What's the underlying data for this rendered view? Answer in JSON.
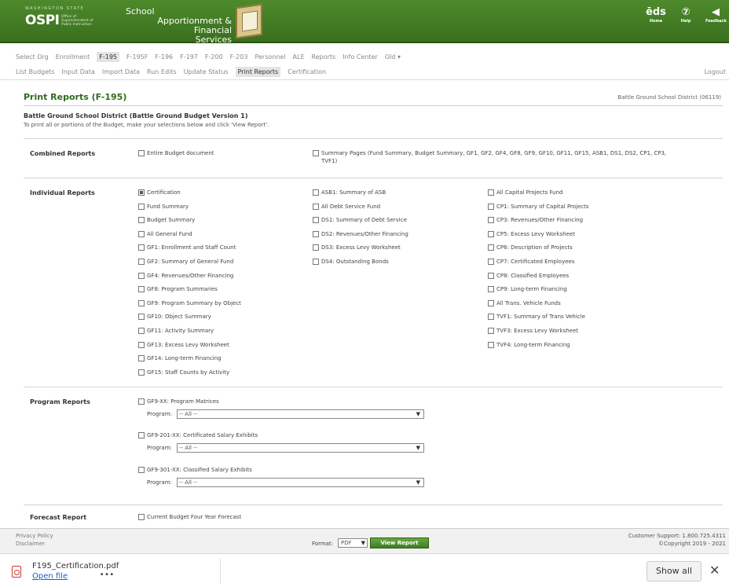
{
  "header": {
    "logo_small": "WASHINGTON STATE",
    "logo_main": "OSPI",
    "logo_sub": "Office of Superintendent of Public Instruction",
    "app_title_1": "School",
    "app_title_2": "Apportionment & Financial",
    "app_title_3": "Services",
    "icons": [
      {
        "glyph": "ēds",
        "label": "Home",
        "icon": "eds-home-icon"
      },
      {
        "glyph": "⑦",
        "label": "Help",
        "icon": "help-icon"
      },
      {
        "glyph": "◀",
        "label": "Feedback",
        "icon": "megaphone-icon"
      }
    ]
  },
  "nav1": {
    "items": [
      "Select Org",
      "Enrollment",
      "F-195",
      "F-195F",
      "F-196",
      "F-197",
      "F-200",
      "F-203",
      "Personnel",
      "ALE",
      "Reports",
      "Info Center",
      "Old ▾"
    ],
    "active_index": 2
  },
  "nav2": {
    "items": [
      "List Budgets",
      "Input Data",
      "Import Data",
      "Run Edits",
      "Update Status",
      "Print Reports",
      "Certification"
    ],
    "active_index": 5,
    "logout": "Logout"
  },
  "page": {
    "title": "Print Reports (F-195)",
    "district": "Battle Ground School District (06119)",
    "budget_name": "Battle Ground School District (Battle Ground Budget Version 1)",
    "instructions": "To print all or portions of the Budget, make your selections below and click 'View Report'."
  },
  "combined": {
    "label": "Combined Reports",
    "entire": "Entire Budget document",
    "summary": "Summary Pages (Fund Summary, Budget Summary, GF1, GF2, GF4, GF8, GF9, GF10, GF11, GF15, ASB1, DS1, DS2, CP1, CP3, TVF1)"
  },
  "individual": {
    "label": "Individual Reports",
    "col1": [
      "Certification",
      "Fund Summary",
      "Budget Summary",
      "All General Fund",
      "GF1: Enrollment and Staff Count",
      "GF2: Summary of General Fund",
      "GF4: Revenues/Other Financing",
      "GF8: Program Summaries",
      "GF9: Program Summary by Object",
      "GF10: Object Summary",
      "GF11: Activity Summary",
      "GF13: Excess Levy Worksheet",
      "GF14: Long-term Financing",
      "GF15: Staff Counts by Activity"
    ],
    "col2": [
      "ASB1: Summary of ASB",
      "All Debt Service Fund",
      "DS1: Summary of Debt Service",
      "DS2: Revenues/Other Financing",
      "DS3: Excess Levy Worksheet",
      "DS4: Outstanding Bonds"
    ],
    "col3": [
      "All Capital Projects Fund",
      "CP1: Summary of Capital Projects",
      "CP3: Revenues/Other Financing",
      "CP5: Excess Levy Worksheet",
      "CP6: Description of Projects",
      "CP7: Certificated Employees",
      "CP8: Classified Employees",
      "CP9: Long-term Financing",
      "All Trans. Vehicle Funds",
      "TVF1: Summary of Trans Vehicle",
      "TVF3: Excess Levy Worksheet",
      "TVF4: Long-term Financing"
    ]
  },
  "program": {
    "label": "Program Reports",
    "items": [
      {
        "name": "GF9-XX: Program Matrices",
        "prog_label": "Program:",
        "value": "-- All --"
      },
      {
        "name": "GF9-201-XX: Certificated Salary Exhibits",
        "prog_label": "Program:",
        "value": "-- All --"
      },
      {
        "name": "GF9-301-XX: Classified Salary Exhibits",
        "prog_label": "Program:",
        "value": "-- All --"
      }
    ]
  },
  "forecast": {
    "label": "Forecast Report",
    "item": "Current Budget Four Year Forecast"
  },
  "footer": {
    "privacy": "Privacy Policy",
    "disclaimer": "Disclaimer",
    "format_label": "Format:",
    "format_value": "PDF",
    "view_button": "View Report",
    "support": "Customer Support: 1.800.725.4311",
    "copyright": "©Copyright 2019 - 2021"
  },
  "download": {
    "filename": "F195_Certification.pdf",
    "open": "Open file",
    "more": "...",
    "show_all": "Show all",
    "close": "✕"
  }
}
